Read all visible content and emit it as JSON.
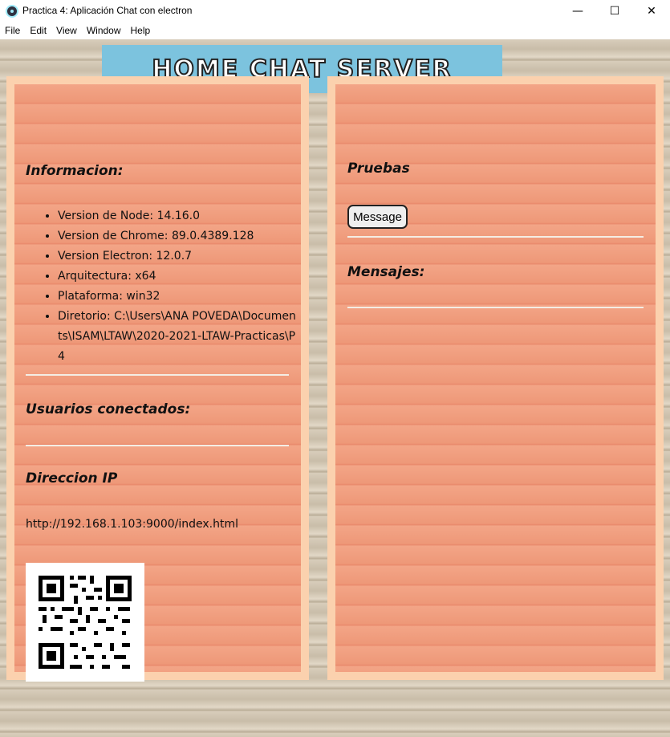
{
  "window": {
    "title": "Practica 4: Aplicación Chat con electron",
    "minimize_glyph": "—",
    "maximize_glyph": "☐",
    "close_glyph": "✕"
  },
  "menu": [
    "File",
    "Edit",
    "View",
    "Window",
    "Help"
  ],
  "banner": {
    "title": "HOME CHAT SERVER"
  },
  "left": {
    "info_heading": "Informacion:",
    "info_items": [
      "Version de Node: 14.16.0",
      "Version de Chrome: 89.0.4389.128",
      "Version Electron: 12.0.7",
      "Arquitectura: x64",
      "Plataforma: win32",
      "Diretorio: C:\\Users\\ANA POVEDA\\Documents\\ISAM\\LTAW\\2020-2021-LTAW-Practicas\\P4"
    ],
    "users_heading": "Usuarios conectados:",
    "ip_heading": "Direccion IP",
    "ip_url": "http://192.168.1.103:9000/index.html"
  },
  "right": {
    "tests_heading": "Pruebas",
    "message_button": "Message",
    "messages_heading": "Mensajes:"
  },
  "colors": {
    "banner": "#7cc3de",
    "panel": "#f19d7d",
    "panel_frame": "#fbd1ae"
  }
}
